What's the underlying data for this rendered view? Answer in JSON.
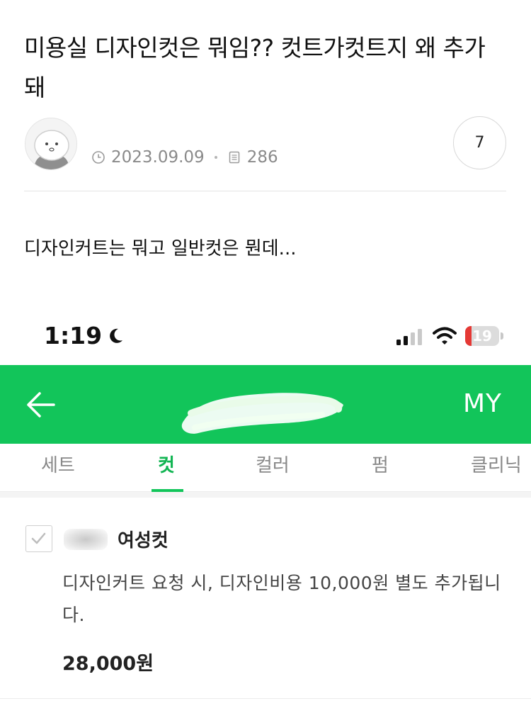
{
  "post": {
    "title": "미용실 디자인컷은 뭐임?? 컷트가컷트지 왜 추가돼",
    "date": "2023.09.09",
    "views": "286",
    "comment_count": "7",
    "body": "디자인커트는 뭐고 일반컷은 뭔데..."
  },
  "embedded_screenshot": {
    "status_bar": {
      "time": "1:19",
      "battery": "19",
      "battery_fraction": 0.19
    },
    "app_bar": {
      "right_label": "MY",
      "accent_color": "#12c55a"
    },
    "tabs": [
      {
        "label": "세트",
        "active": false
      },
      {
        "label": "컷",
        "active": true
      },
      {
        "label": "컬러",
        "active": false
      },
      {
        "label": "펌",
        "active": false
      },
      {
        "label": "클리닉",
        "active": false
      }
    ],
    "item": {
      "name": "여성컷",
      "description": "디자인커트 요청 시, 디자인비용 10,000원 별도 추가됩니다.",
      "price": "28,000원",
      "checked": true
    }
  },
  "icons": [
    "clock-icon",
    "document-icon",
    "back-arrow-icon",
    "moon-icon",
    "signal-icon",
    "wifi-icon",
    "battery-icon",
    "checkmark-icon"
  ]
}
